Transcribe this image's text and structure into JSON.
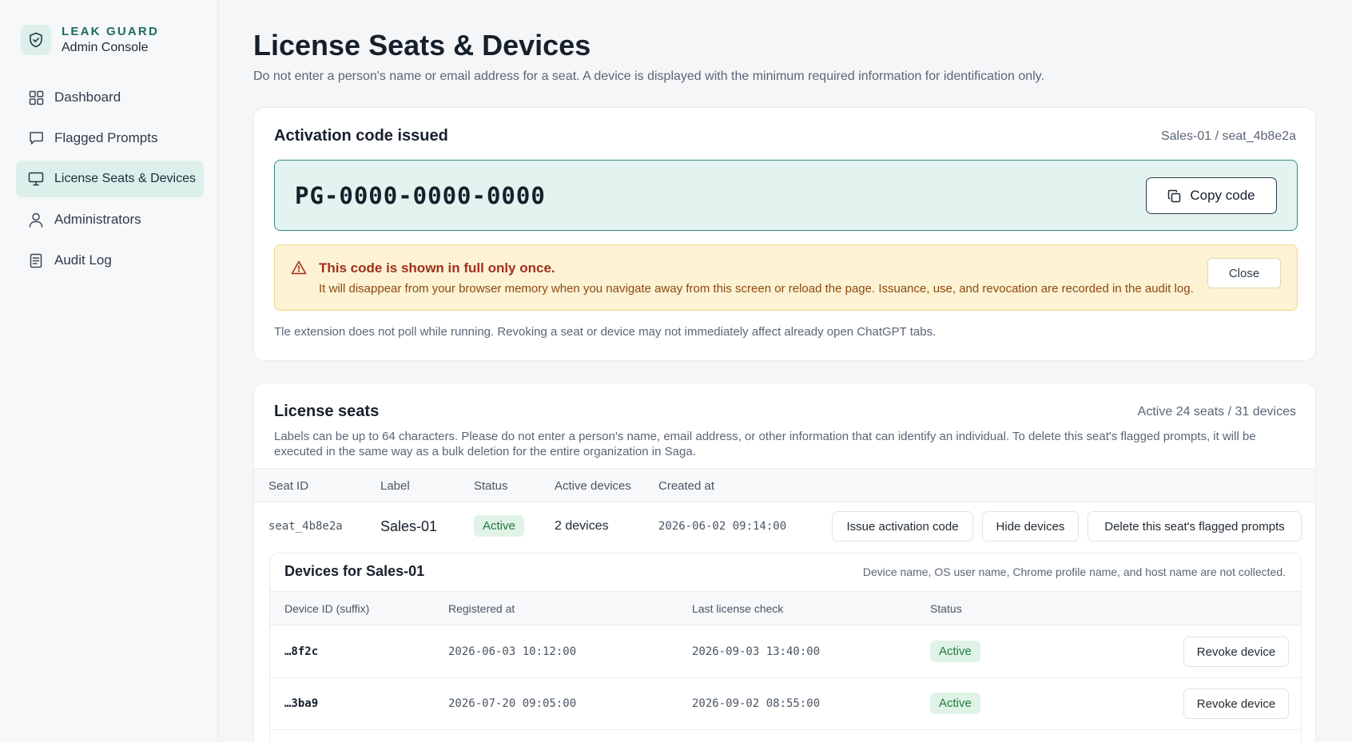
{
  "brand": {
    "title": "LEAK GUARD",
    "subtitle": "Admin Console",
    "logo_icon": "shield-check-icon"
  },
  "nav": {
    "items": [
      {
        "label": "Dashboard",
        "icon": "grid-icon"
      },
      {
        "label": "Flagged Prompts",
        "icon": "chat-bubble-icon"
      },
      {
        "label": "License Seats & Devices",
        "icon": "monitor-icon",
        "active": true
      },
      {
        "label": "Administrators",
        "icon": "user-icon"
      },
      {
        "label": "Audit Log",
        "icon": "document-icon"
      }
    ]
  },
  "page": {
    "title": "License Seats & Devices",
    "description": "Do not enter a person's name or email address for a seat. A device is displayed with the minimum required information for identification only."
  },
  "activation": {
    "title": "Activation code issued",
    "meta": "Sales-01 / seat_4b8e2a",
    "code": "PG-0000-0000-0000",
    "copy_label": "Copy code",
    "warning_title": "This code is shown in full only once.",
    "warning_body": "It will disappear from your browser memory when you navigate away from this screen or reload the page. Issuance, use, and revocation are recorded in the audit log.",
    "close_label": "Close",
    "note": "Tle extension does not poll while running. Revoking a seat or device may not immediately affect already open ChatGPT tabs."
  },
  "seats": {
    "title": "License seats",
    "meta": "Active 24 seats / 31 devices",
    "description": "Labels can be up to 64 characters. Please do not enter a person's name, email address, or other information that can identify an individual. To delete this seat's flagged prompts, it will be executed in the same way as a bulk deletion for the entire organization in Saga.",
    "columns": [
      "Seat ID",
      "Label",
      "Status",
      "Active devices",
      "Created at"
    ],
    "row": {
      "seat_id": "seat_4b8e2a",
      "label": "Sales-01",
      "status": "Active",
      "active_devices": "2 devices",
      "created_at": "2026-06-02 09:14:00",
      "issue_label": "Issue activation code",
      "hide_label": "Hide devices",
      "delete_label": "Delete this seat's flagged prompts"
    }
  },
  "devices": {
    "title": "Devices for Sales-01",
    "meta": "Device name, OS user name, Chrome profile name, and host name are not collected.",
    "columns": [
      "Device ID (suffix)",
      "Registered at",
      "Last license check",
      "Status"
    ],
    "rows": [
      {
        "device_id": "…8f2c",
        "registered_at": "2026-06-03 10:12:00",
        "last_check": "2026-09-03 13:40:00",
        "status": "Active",
        "revoke_label": "Revoke device"
      },
      {
        "device_id": "…3ba9",
        "registered_at": "2026-07-20 09:05:00",
        "last_check": "2026-09-02 08:55:00",
        "status": "Active",
        "revoke_label": "Revoke device"
      }
    ]
  },
  "colors": {
    "accent": "#1d6b5f",
    "accent_bg": "#dcefeb",
    "warning_bg": "#fdf2d3",
    "warning_text": "#a0311d",
    "success": "#1f7a3d"
  }
}
